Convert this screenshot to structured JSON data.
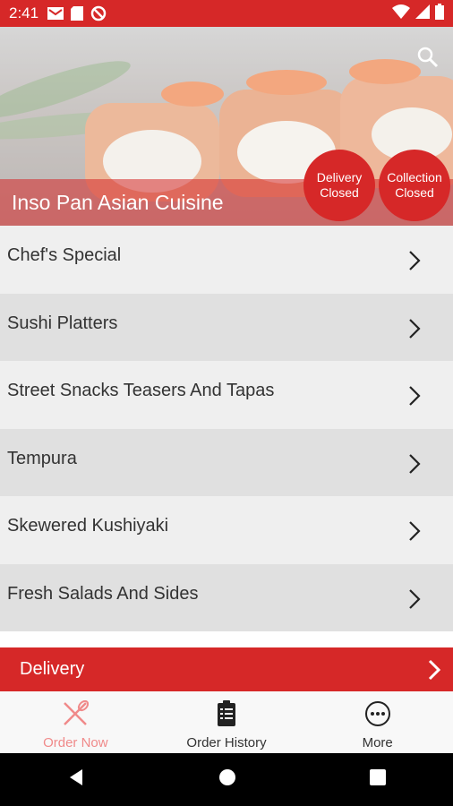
{
  "status_bar": {
    "time": "2:41",
    "icons": [
      "mail-icon",
      "sd-card-icon",
      "do-not-disturb-icon"
    ],
    "right_icons": [
      "wifi-icon",
      "signal-icon",
      "battery-icon"
    ]
  },
  "hero": {
    "restaurant_name": "Inso Pan Asian Cuisine",
    "delivery_badge": [
      "Delivery",
      "Closed"
    ],
    "collection_badge": [
      "Collection",
      "Closed"
    ]
  },
  "menu": {
    "items": [
      {
        "label": "Chef's Special"
      },
      {
        "label": "Sushi Platters"
      },
      {
        "label": "Street Snacks Teasers And Tapas"
      },
      {
        "label": "Tempura"
      },
      {
        "label": "Skewered Kushiyaki"
      },
      {
        "label": "Fresh Salads And Sides"
      }
    ]
  },
  "delivery_bar": {
    "label": "Delivery"
  },
  "bottom_nav": {
    "items": [
      {
        "label": "Order Now",
        "icon": "fork-knife-icon",
        "active": true
      },
      {
        "label": "Order History",
        "icon": "clipboard-icon",
        "active": false
      },
      {
        "label": "More",
        "icon": "more-icon",
        "active": false
      }
    ]
  },
  "colors": {
    "accent": "#d62828",
    "active_nav": "#f08a8a"
  }
}
